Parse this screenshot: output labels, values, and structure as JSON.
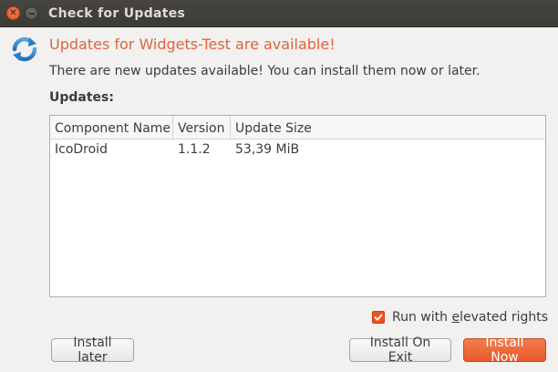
{
  "window": {
    "title": "Check for Updates"
  },
  "header": {
    "headline": "Updates for Widgets-Test are available!",
    "subtext": "There are new updates available! You can install them now or later.",
    "updates_label": "Updates:"
  },
  "table": {
    "columns": [
      "Component Name",
      "Version",
      "Update Size"
    ],
    "rows": [
      {
        "name": "IcoDroid",
        "version": "1.1.2",
        "size": "53,39 MiB"
      }
    ]
  },
  "options": {
    "elevated_prefix": "Run with ",
    "elevated_mnemonic": "e",
    "elevated_suffix": "levated rights",
    "elevated_checked": true
  },
  "buttons": {
    "install_later": "Install later",
    "install_on_exit": "Install On Exit",
    "install_now": "Install Now"
  },
  "icons": {
    "app": "refresh-icon",
    "close": "close-icon",
    "minimize": "minimize-icon"
  },
  "colors": {
    "accent": "#e95420",
    "headline": "#e0643a"
  }
}
